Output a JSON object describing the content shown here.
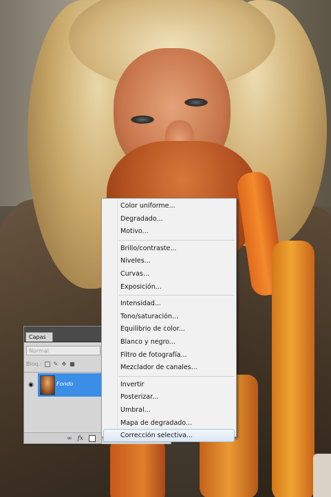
{
  "layers_panel": {
    "tab_label": "Capas",
    "blend_mode": "Normal",
    "lock_label": "Bloq.:",
    "layers": [
      {
        "name": "Fondo",
        "visible": true,
        "selected": true
      }
    ],
    "footer_icons": [
      "link-icon",
      "fx-icon",
      "new-fill-layer-icon"
    ]
  },
  "adjustment_menu": {
    "groups": [
      [
        "Color uniforme...",
        "Degradado...",
        "Motivo..."
      ],
      [
        "Brillo/contraste...",
        "Niveles...",
        "Curvas...",
        "Exposición..."
      ],
      [
        "Intensidad...",
        "Tono/saturación...",
        "Equilibrio de color...",
        "Blanco y negro...",
        "Filtro de fotografía...",
        "Mezclador de canales..."
      ],
      [
        "Invertir",
        "Posterizar...",
        "Umbral...",
        "Mapa de degradado...",
        "Corrección selectiva..."
      ]
    ],
    "highlighted_item": "Corrección selectiva...",
    "highlight_color": "#dde8f4"
  }
}
